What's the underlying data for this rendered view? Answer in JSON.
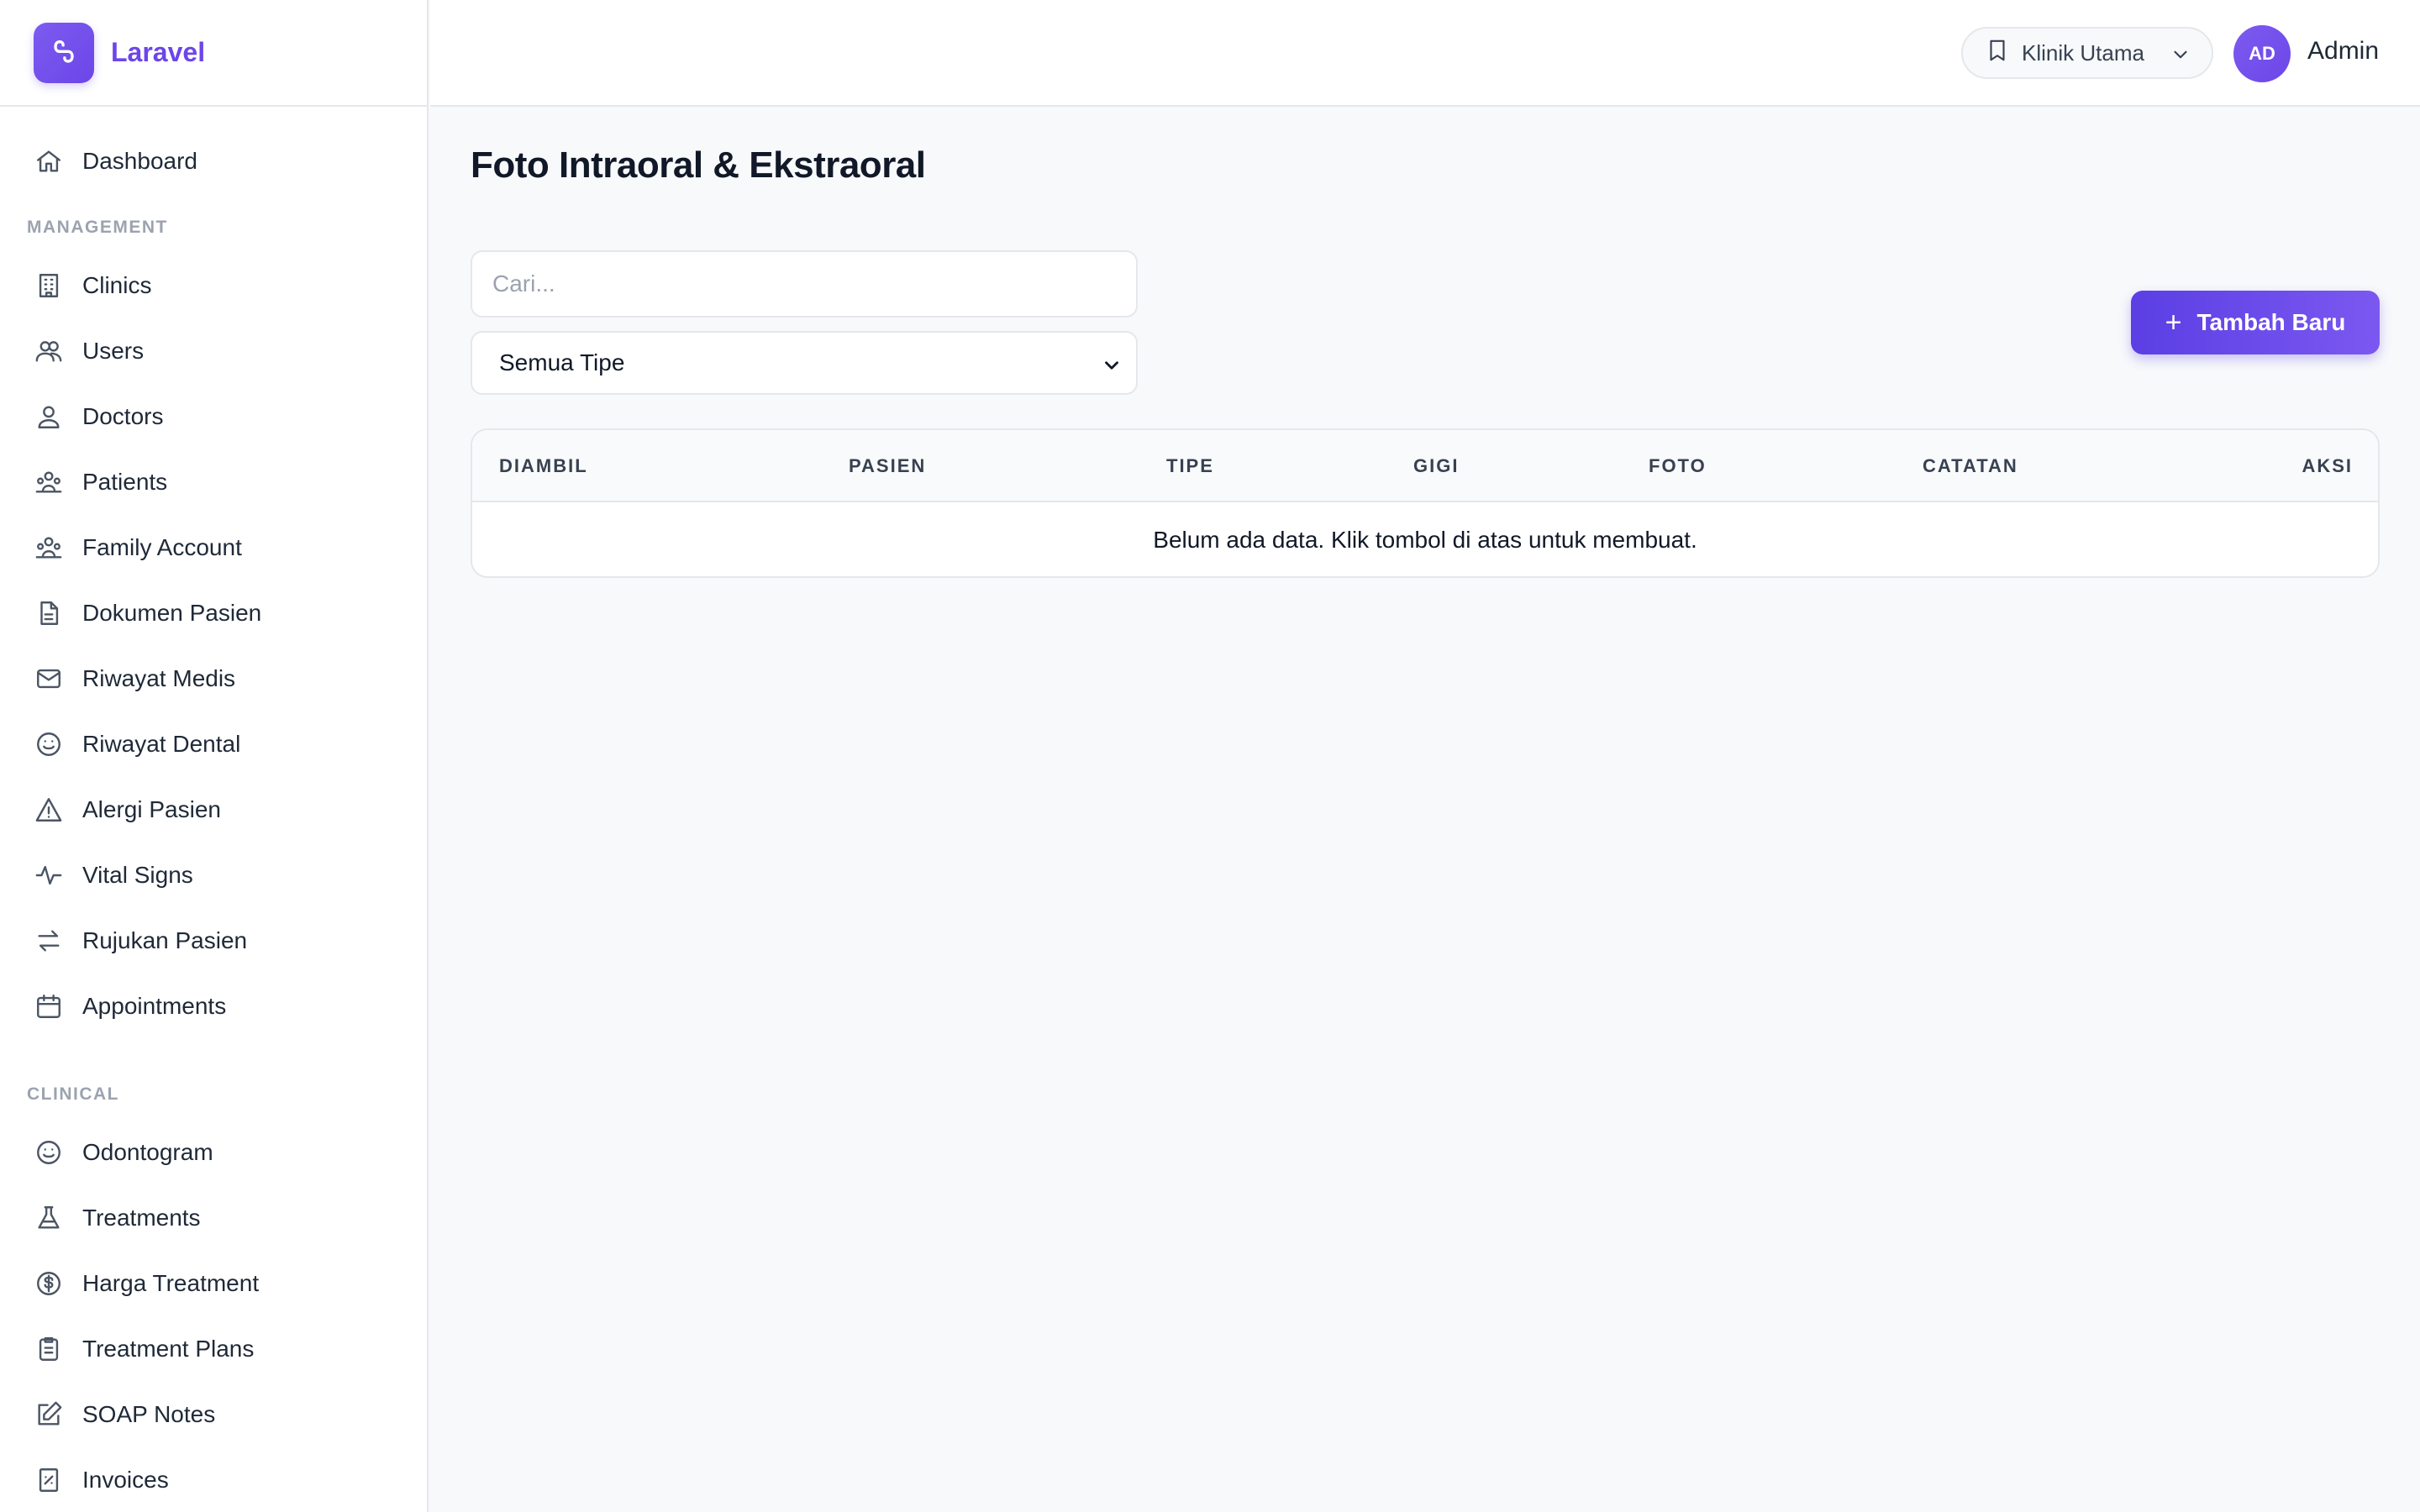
{
  "brand": {
    "name": "Laravel"
  },
  "sidebar": {
    "top_items": [
      {
        "label": "Dashboard",
        "icon": "home-icon"
      }
    ],
    "sections": [
      {
        "title": "MANAGEMENT",
        "items": [
          {
            "label": "Clinics",
            "icon": "building-icon"
          },
          {
            "label": "Users",
            "icon": "users-icon"
          },
          {
            "label": "Doctors",
            "icon": "user-icon"
          },
          {
            "label": "Patients",
            "icon": "user-group-icon"
          },
          {
            "label": "Family Account",
            "icon": "user-group-icon"
          },
          {
            "label": "Dokumen Pasien",
            "icon": "document-icon"
          },
          {
            "label": "Riwayat Medis",
            "icon": "envelope-icon"
          },
          {
            "label": "Riwayat Dental",
            "icon": "smile-icon"
          },
          {
            "label": "Alergi Pasien",
            "icon": "warning-icon"
          },
          {
            "label": "Vital Signs",
            "icon": "pulse-icon"
          },
          {
            "label": "Rujukan Pasien",
            "icon": "arrows-icon"
          },
          {
            "label": "Appointments",
            "icon": "calendar-icon"
          }
        ]
      },
      {
        "title": "CLINICAL",
        "items": [
          {
            "label": "Odontogram",
            "icon": "smile-icon"
          },
          {
            "label": "Treatments",
            "icon": "flask-icon"
          },
          {
            "label": "Harga Treatment",
            "icon": "dollar-icon"
          },
          {
            "label": "Treatment Plans",
            "icon": "clipboard-icon"
          },
          {
            "label": "SOAP Notes",
            "icon": "edit-icon"
          },
          {
            "label": "Invoices",
            "icon": "receipt-icon"
          }
        ]
      }
    ]
  },
  "header": {
    "clinic_selector": "Klinik Utama",
    "user": {
      "initials": "AD",
      "name": "Admin"
    }
  },
  "main": {
    "title": "Foto Intraoral & Ekstraoral",
    "search": {
      "placeholder": "Cari..."
    },
    "type_filter": {
      "selected": "Semua Tipe"
    },
    "add_button": "Tambah Baru",
    "table": {
      "columns": [
        "DIAMBIL",
        "PASIEN",
        "TIPE",
        "GIGI",
        "FOTO",
        "CATATAN",
        "AKSI"
      ],
      "empty_message": "Belum ada data. Klik tombol di atas untuk membuat."
    }
  },
  "colors": {
    "accent": "#6d45e8",
    "background": "#f8f9fb",
    "border": "#e5e7eb"
  }
}
